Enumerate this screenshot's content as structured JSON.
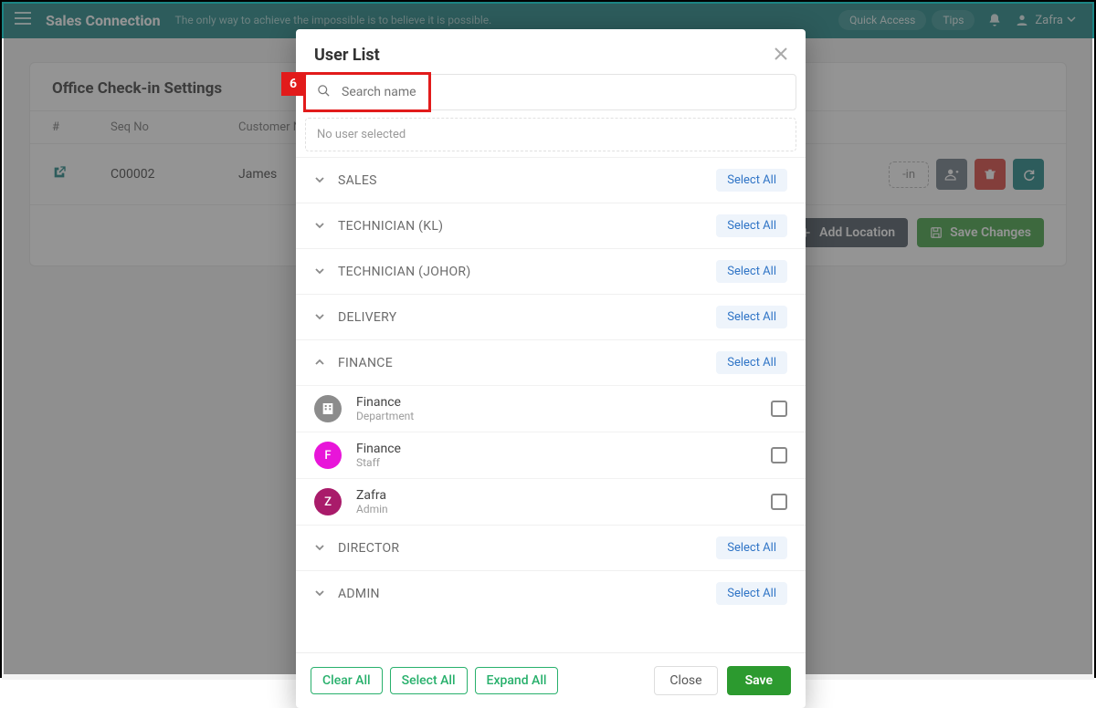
{
  "callout_number": "6",
  "topbar": {
    "brand": "Sales Connection",
    "tagline": "The only way to achieve the impossible is to believe it is possible.",
    "quick_access": "Quick Access",
    "tips": "Tips",
    "user_name": "Zafra"
  },
  "card": {
    "title": "Office Check-in Settings",
    "columns": {
      "num": "#",
      "seq": "Seq No",
      "cust": "Customer Name"
    },
    "row": {
      "seq": "C00002",
      "cust": "James",
      "chip": "-in"
    },
    "add_location": "Add Location",
    "save_changes": "Save Changes"
  },
  "modal": {
    "title": "User List",
    "search_placeholder": "Search name",
    "no_selection": "No user selected",
    "select_all_label": "Select All",
    "groups_collapsed": [
      "SALES",
      "TECHNICIAN (KL)",
      "TECHNICIAN (JOHOR)",
      "DELIVERY"
    ],
    "group_expanded": "FINANCE",
    "users": [
      {
        "name": "Finance",
        "role": "Department",
        "avatar_kind": "building"
      },
      {
        "name": "Finance",
        "role": "Staff",
        "avatar_letter": "F",
        "avatar_class": "ava-mag"
      },
      {
        "name": "Zafra",
        "role": "Admin",
        "avatar_letter": "Z",
        "avatar_class": "ava-purple"
      }
    ],
    "groups_after": [
      "DIRECTOR",
      "ADMIN"
    ],
    "footer": {
      "clear_all": "Clear All",
      "select_all": "Select All",
      "expand_all": "Expand All",
      "close": "Close",
      "save": "Save"
    }
  }
}
